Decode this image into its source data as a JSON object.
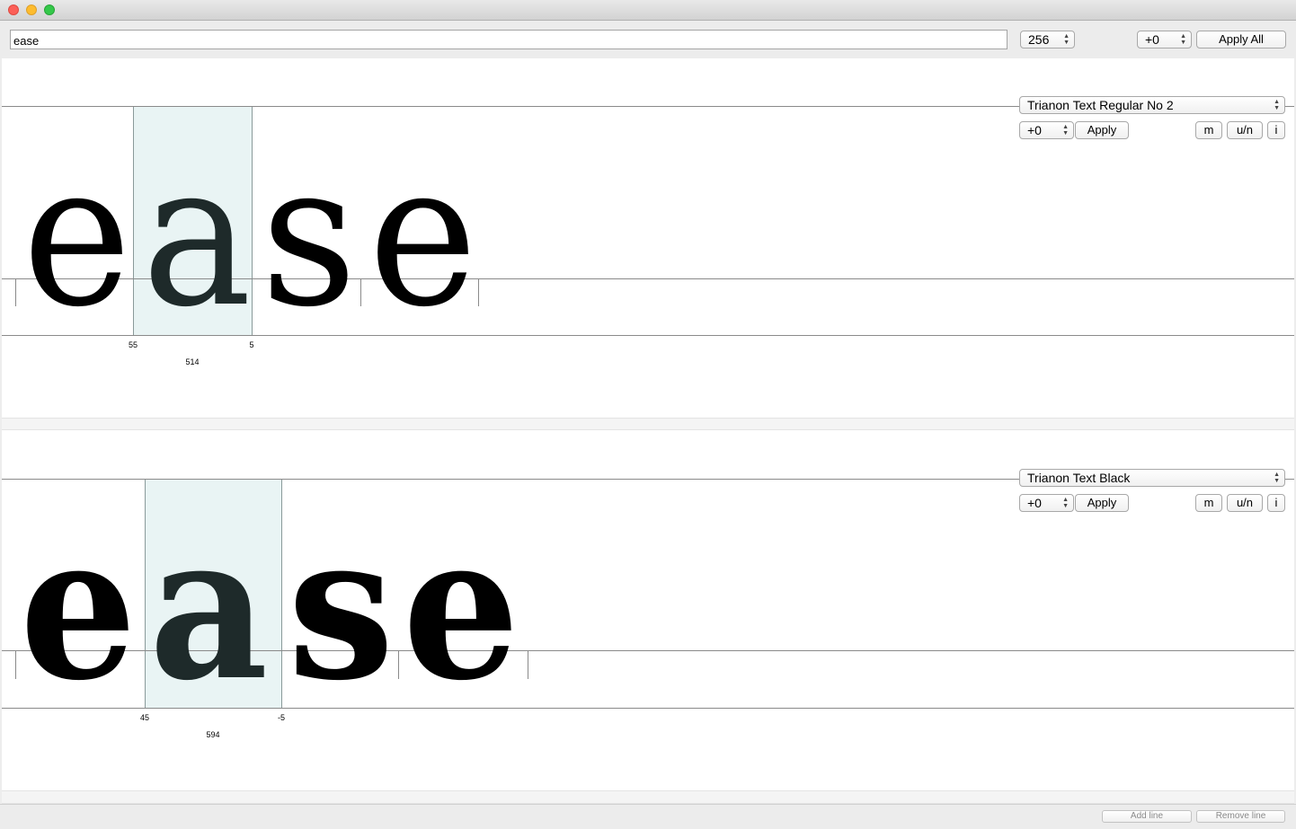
{
  "window": {
    "title": ""
  },
  "toolbar": {
    "text_value": "ease",
    "size_value": "256",
    "global_kern_value": "+0",
    "apply_all_label": "Apply All"
  },
  "lines": [
    {
      "font_name": "Trianon Text Regular No 2",
      "kern_value": "+0",
      "apply_label": "Apply",
      "m_label": "m",
      "un_label": "u/n",
      "i_label": "i",
      "glyphs": [
        "e",
        "a",
        "s",
        "e"
      ],
      "selected_glyph": "a",
      "left_sidebearing": "55",
      "right_sidebearing": "5",
      "advance_width": "514",
      "weight": "regular"
    },
    {
      "font_name": "Trianon Text Black",
      "kern_value": "+0",
      "apply_label": "Apply",
      "m_label": "m",
      "un_label": "u/n",
      "i_label": "i",
      "glyphs": [
        "e",
        "a",
        "s",
        "e"
      ],
      "selected_glyph": "a",
      "left_sidebearing": "45",
      "right_sidebearing": "-5",
      "advance_width": "594",
      "weight": "black"
    }
  ],
  "footer": {
    "add_line_label": "Add line",
    "remove_line_label": "Remove line"
  },
  "icons": {
    "close": "close-icon",
    "minimize": "minimize-icon",
    "zoom": "zoom-icon",
    "stepper": "stepper-arrows-icon",
    "popup": "popup-arrows-icon"
  },
  "colors": {
    "highlight": "#e9f4f4",
    "close": "#fc5f57",
    "minimize": "#fdbc2e",
    "zoom": "#34c84a"
  }
}
